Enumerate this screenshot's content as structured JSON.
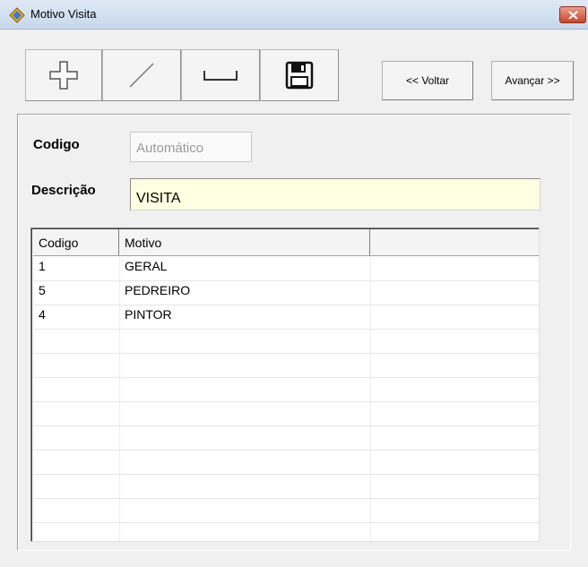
{
  "window": {
    "title": "Motivo Visita"
  },
  "toolbar": {
    "buttons": [
      {
        "icon": "plus-icon"
      },
      {
        "icon": "pencil-line-icon"
      },
      {
        "icon": "cancel-bracket-icon"
      },
      {
        "icon": "floppy-disk-icon"
      }
    ],
    "back_label": "<< Voltar",
    "next_label": "Avançar >>"
  },
  "form": {
    "codigo_label": "Codigo",
    "codigo_placeholder": "Automático",
    "descricao_label": "Descrição",
    "descricao_value": "VISITA"
  },
  "table": {
    "headers": [
      "Codigo",
      "Motivo",
      ""
    ],
    "rows": [
      {
        "codigo": "1",
        "motivo": "GERAL"
      },
      {
        "codigo": "5",
        "motivo": "PEDREIRO"
      },
      {
        "codigo": "4",
        "motivo": "PINTOR"
      },
      {
        "codigo": "",
        "motivo": ""
      },
      {
        "codigo": "",
        "motivo": ""
      },
      {
        "codigo": "",
        "motivo": ""
      },
      {
        "codigo": "",
        "motivo": ""
      },
      {
        "codigo": "",
        "motivo": ""
      },
      {
        "codigo": "",
        "motivo": ""
      },
      {
        "codigo": "",
        "motivo": ""
      },
      {
        "codigo": "",
        "motivo": ""
      },
      {
        "codigo": "",
        "motivo": ""
      }
    ]
  },
  "colors": {
    "input_highlight": "#ffffe1",
    "title_bar": "#c7d8ec",
    "close_button": "#c8452a"
  }
}
